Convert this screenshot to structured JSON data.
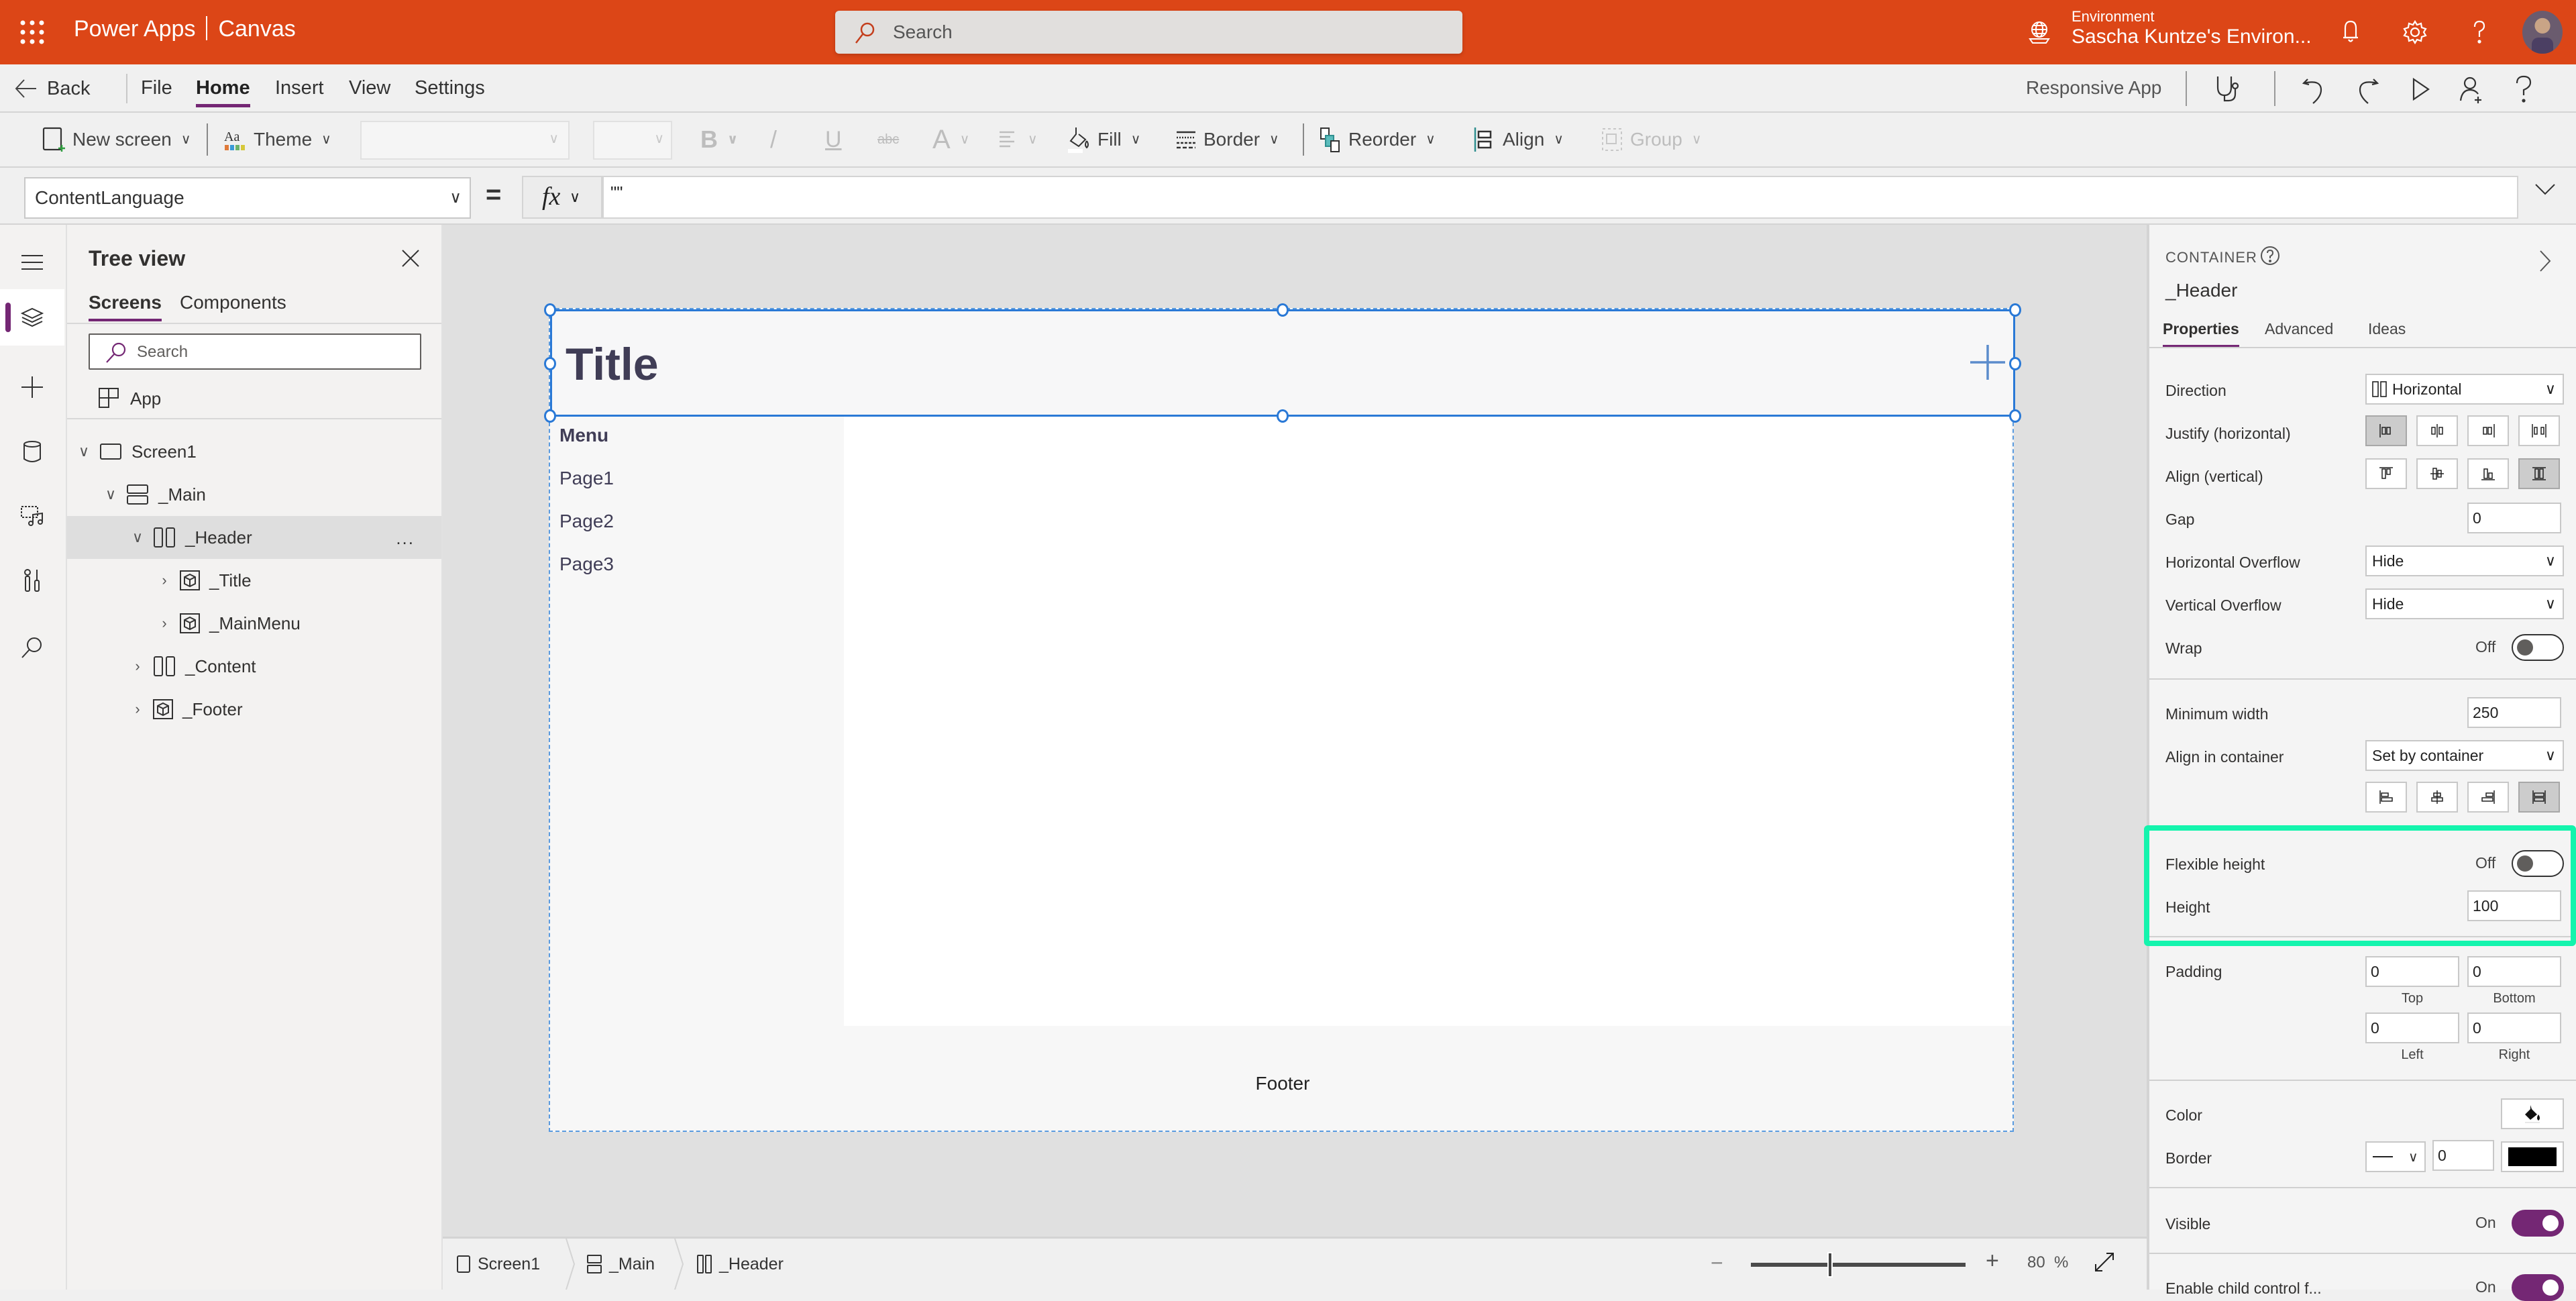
{
  "topbar": {
    "app_name": "Power Apps",
    "app_mode": "Canvas",
    "search_placeholder": "Search",
    "environment_label": "Environment",
    "environment_name": "Sascha Kuntze's Environ...",
    "brand_color": "#dc4617"
  },
  "menubar": {
    "back": "Back",
    "items": [
      "File",
      "Home",
      "Insert",
      "View",
      "Settings"
    ],
    "active_item": "Home",
    "app_type": "Responsive App"
  },
  "toolbar": {
    "new_screen": "New screen",
    "theme": "Theme",
    "fill": "Fill",
    "border": "Border",
    "reorder": "Reorder",
    "align": "Align",
    "group": "Group",
    "bold": "B",
    "italic": "/",
    "underline": "U",
    "strike": "abc",
    "font_color": "A"
  },
  "formula": {
    "property": "ContentLanguage",
    "equals": "=",
    "fx": "fx",
    "value": "\"\""
  },
  "tree": {
    "title": "Tree view",
    "tabs": [
      "Screens",
      "Components"
    ],
    "active_tab": "Screens",
    "search_placeholder": "Search",
    "app_node": "App",
    "nodes": [
      {
        "label": "Screen1",
        "type": "screen",
        "expanded": true
      },
      {
        "label": "_Main",
        "type": "vertical-container",
        "expanded": true
      },
      {
        "label": "_Header",
        "type": "horizontal-container",
        "expanded": true,
        "selected": true
      },
      {
        "label": "_Title",
        "type": "component",
        "expanded": false
      },
      {
        "label": "_MainMenu",
        "type": "component",
        "expanded": false
      },
      {
        "label": "_Content",
        "type": "horizontal-container",
        "expanded": false
      },
      {
        "label": "_Footer",
        "type": "component",
        "expanded": false
      }
    ],
    "more": "..."
  },
  "canvas": {
    "title": "Title",
    "menu_heading": "Menu",
    "menu_items": [
      "Page1",
      "Page2",
      "Page3"
    ],
    "footer": "Footer"
  },
  "statusbar": {
    "breadcrumbs": [
      "Screen1",
      "_Main",
      "_Header"
    ],
    "zoom_percent": 80,
    "zoom_label": "80",
    "zoom_unit": "%",
    "zoom_minus": "−",
    "zoom_plus": "+"
  },
  "properties": {
    "type_label": "CONTAINER",
    "name": "_Header",
    "tabs": [
      "Properties",
      "Advanced",
      "Ideas"
    ],
    "active_tab": "Properties",
    "direction_label": "Direction",
    "direction_value": "Horizontal",
    "justify_label": "Justify (horizontal)",
    "justify_selected": "start",
    "align_label": "Align (vertical)",
    "align_selected": "stretch",
    "gap_label": "Gap",
    "gap_value": "0",
    "h_overflow_label": "Horizontal Overflow",
    "h_overflow_value": "Hide",
    "v_overflow_label": "Vertical Overflow",
    "v_overflow_value": "Hide",
    "wrap_label": "Wrap",
    "wrap_state": "Off",
    "min_width_label": "Minimum width",
    "min_width_value": "250",
    "align_in_container_label": "Align in container",
    "align_in_container_value": "Set by container",
    "align_in_container_selected": "stretch",
    "flex_height_label": "Flexible height",
    "flex_height_state": "Off",
    "height_label": "Height",
    "height_value": "100",
    "padding_label": "Padding",
    "padding": {
      "top": "0",
      "bottom": "0",
      "left": "0",
      "right": "0"
    },
    "padding_sublabels": {
      "top": "Top",
      "bottom": "Bottom",
      "left": "Left",
      "right": "Right"
    },
    "color_label": "Color",
    "border_label": "Border",
    "border_width": "0",
    "border_color": "#000000",
    "visible_label": "Visible",
    "visible_state": "On",
    "enable_child_label": "Enable child control f...",
    "enable_child_state": "On",
    "accent_color": "#742774",
    "highlight_color": "#14f4ad"
  }
}
